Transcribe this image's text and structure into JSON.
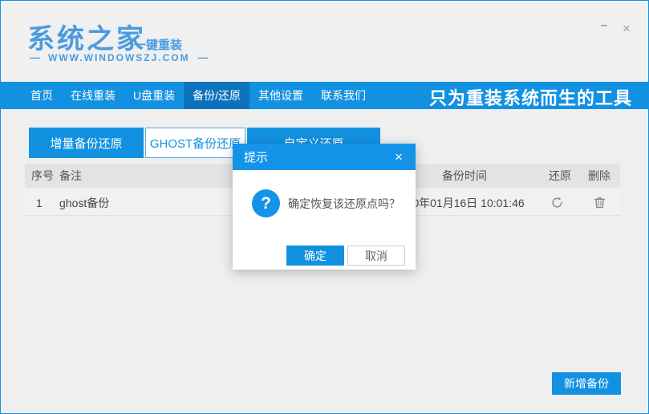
{
  "window_controls": {
    "minimize_glyph": "–",
    "close_glyph": "×"
  },
  "header": {
    "logo_title": "系统之家",
    "logo_subtitle": "一键重装",
    "website": "WWW.WINDOWSZJ.COM",
    "dash_decor": "—"
  },
  "nav": {
    "items": [
      {
        "label": "首页",
        "active": false
      },
      {
        "label": "在线重装",
        "active": false
      },
      {
        "label": "U盘重装",
        "active": false
      },
      {
        "label": "备份/还原",
        "active": true
      },
      {
        "label": "其他设置",
        "active": false
      },
      {
        "label": "联系我们",
        "active": false
      }
    ],
    "slogan": "只为重装系统而生的工具"
  },
  "tabs": [
    {
      "label": "增量备份还原",
      "selected": false
    },
    {
      "label": "GHOST备份还原",
      "selected": true
    },
    {
      "label": "自定义还原",
      "selected": false
    }
  ],
  "table": {
    "headers": {
      "index": "序号",
      "note": "备注",
      "time": "备份时间",
      "restore": "还原",
      "delete": "删除"
    },
    "rows": [
      {
        "index": "1",
        "note": "ghost备份",
        "time": "2020年01月16日 10:01:46"
      }
    ]
  },
  "dialog": {
    "title": "提示",
    "close_glyph": "×",
    "question_glyph": "?",
    "message": "确定恢复该还原点吗？",
    "ok_label": "确定",
    "cancel_label": "取消"
  },
  "footer": {
    "add_backup_label": "新增备份"
  },
  "icons": {
    "restore": "refresh-circular-arrow",
    "delete": "trash-can",
    "minimize": "minus-glyph",
    "close": "x-glyph",
    "question": "question-mark-circle"
  },
  "colors": {
    "primary_blue": "#1291e1",
    "nav_active_blue": "#0d72bd",
    "logo_blue": "#4a9be0",
    "header_bg": "#f0f0f0",
    "content_bg": "#efefef",
    "table_header_bg": "#e3e3e3",
    "table_row_bg": "#f1f1f1",
    "icon_gray": "#8a8a8a"
  }
}
